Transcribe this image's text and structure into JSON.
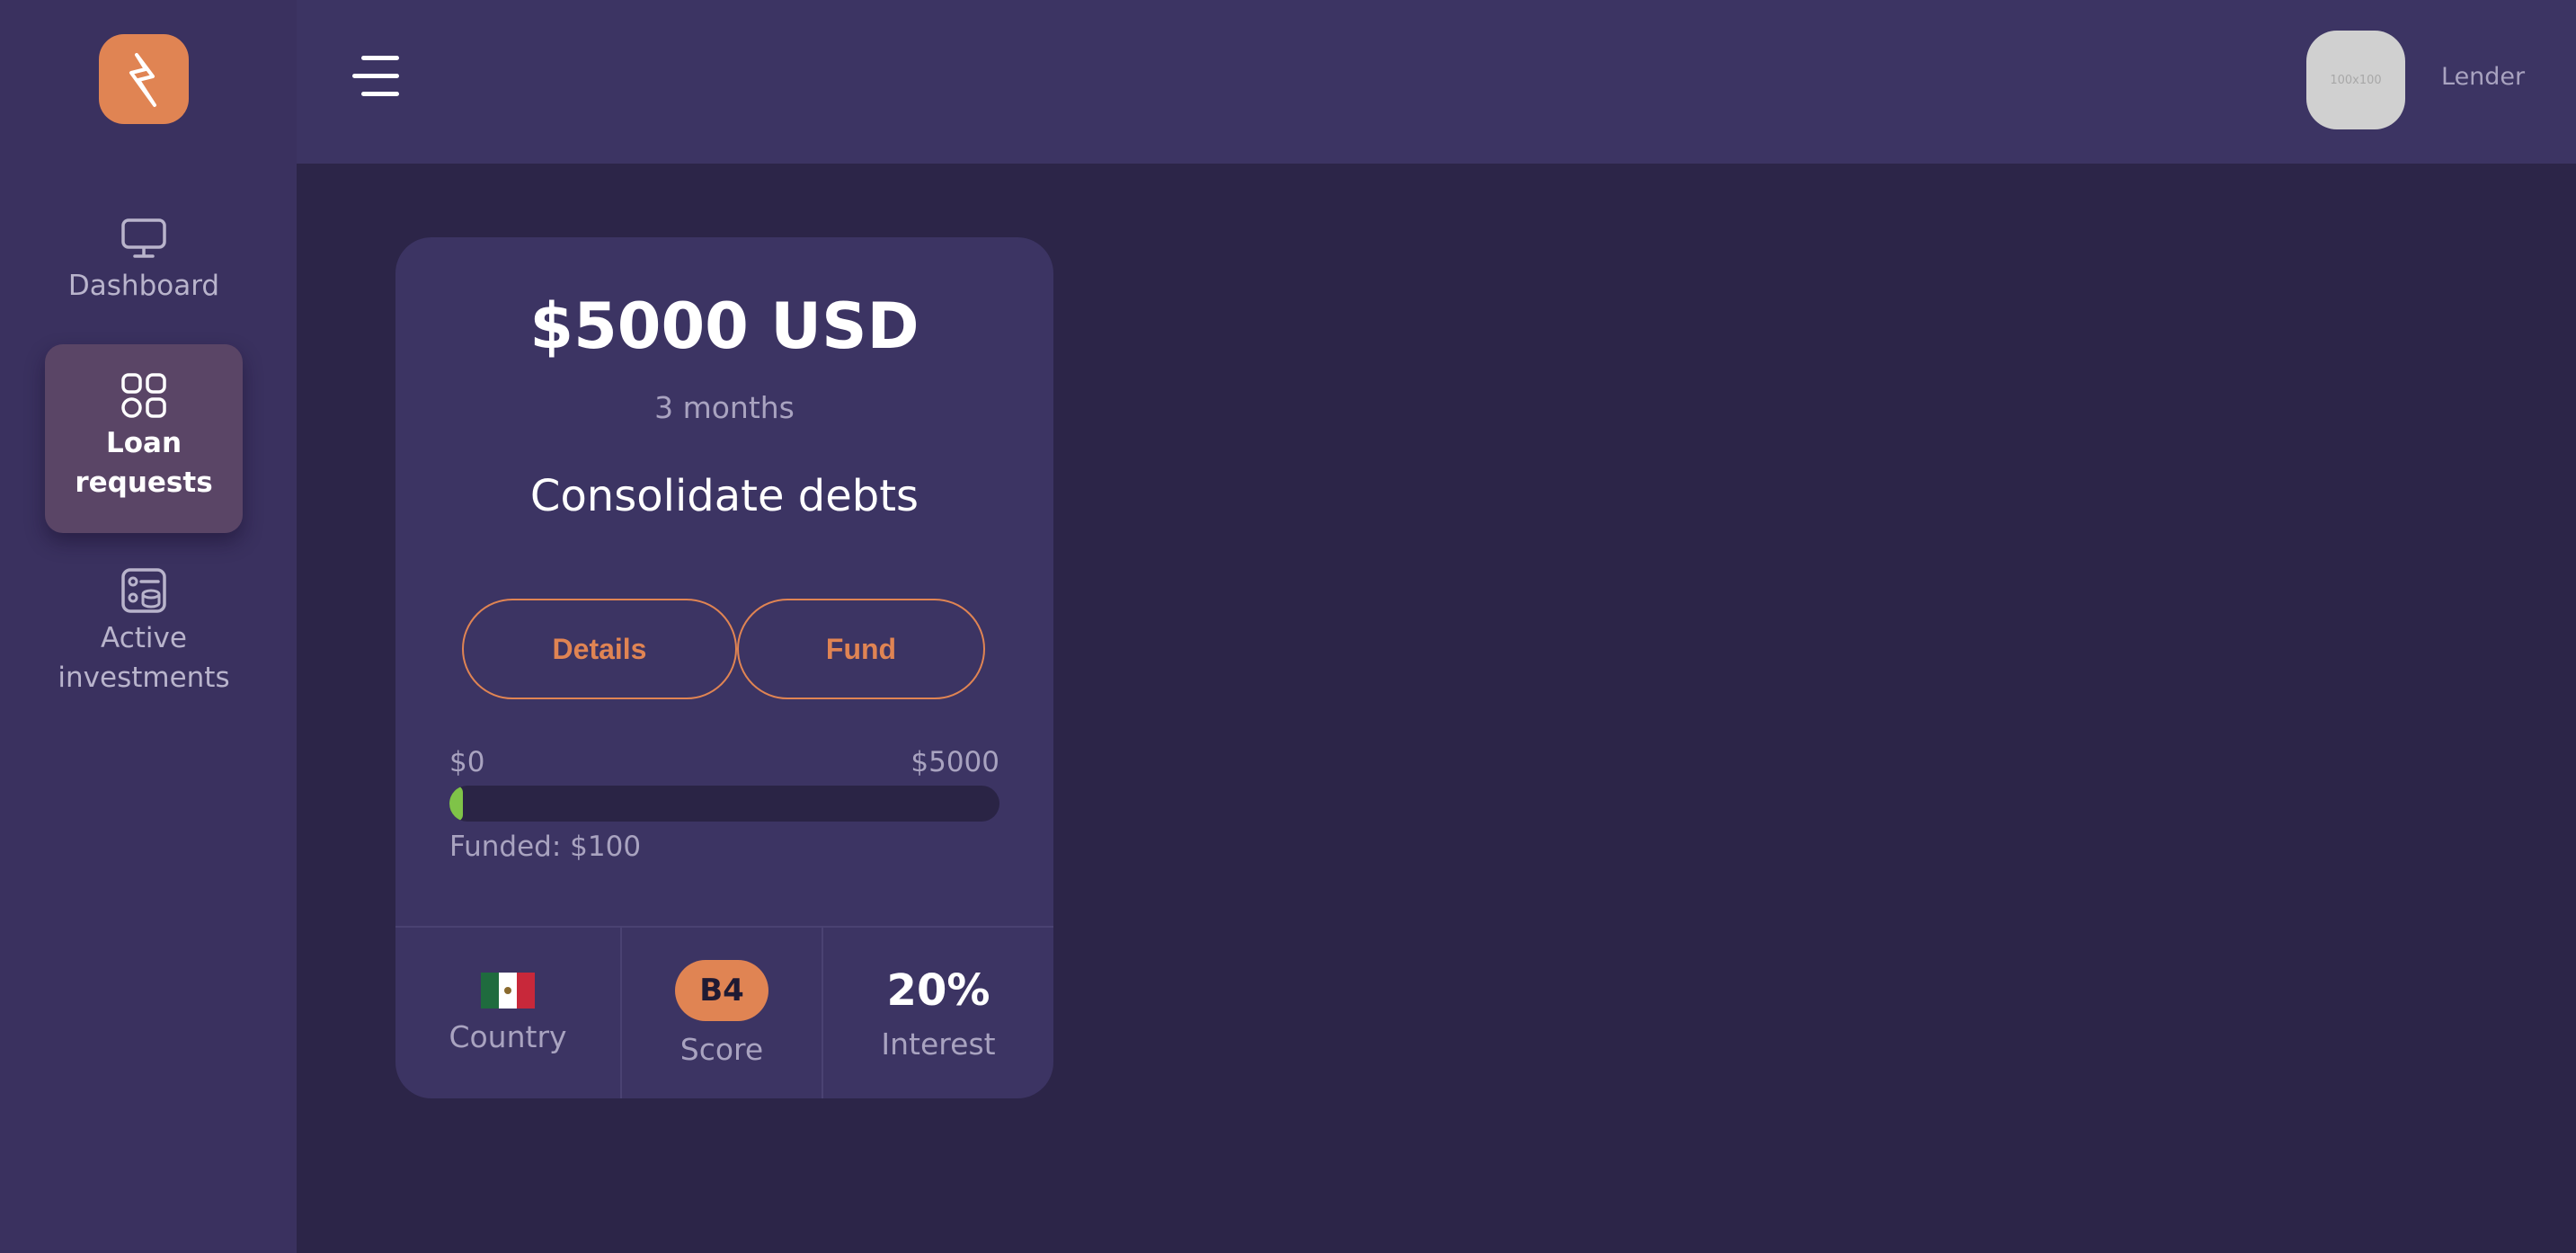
{
  "sidebar": {
    "logo_icon": "lightning-bolt-icon",
    "items": [
      {
        "icon": "monitor-icon",
        "label": "Dashboard"
      },
      {
        "icon": "grid-icon",
        "label": "Loan requests",
        "active": true
      },
      {
        "icon": "investments-icon",
        "label": "Active investments"
      }
    ]
  },
  "header": {
    "menu_icon": "hamburger-icon",
    "avatar_text": "100x100",
    "user_role": "Lender"
  },
  "loan_card": {
    "amount": "$5000 USD",
    "term": "3 months",
    "purpose": "Consolidate debts",
    "details_label": "Details",
    "fund_label": "Fund",
    "range_min": "$0",
    "range_max": "$5000",
    "funded_fraction": 0.02,
    "funded_text": "Funded: $100",
    "country_flag": "mexico-flag",
    "country_label": "Country",
    "score": "B4",
    "score_label": "Score",
    "interest": "20%",
    "interest_label": "Interest"
  },
  "colors": {
    "accent": "#e08453",
    "progress": "#7fc348",
    "sidebar_bg": "#3a315f",
    "content_bg": "#2c2548",
    "card_bg": "#3c3463"
  }
}
